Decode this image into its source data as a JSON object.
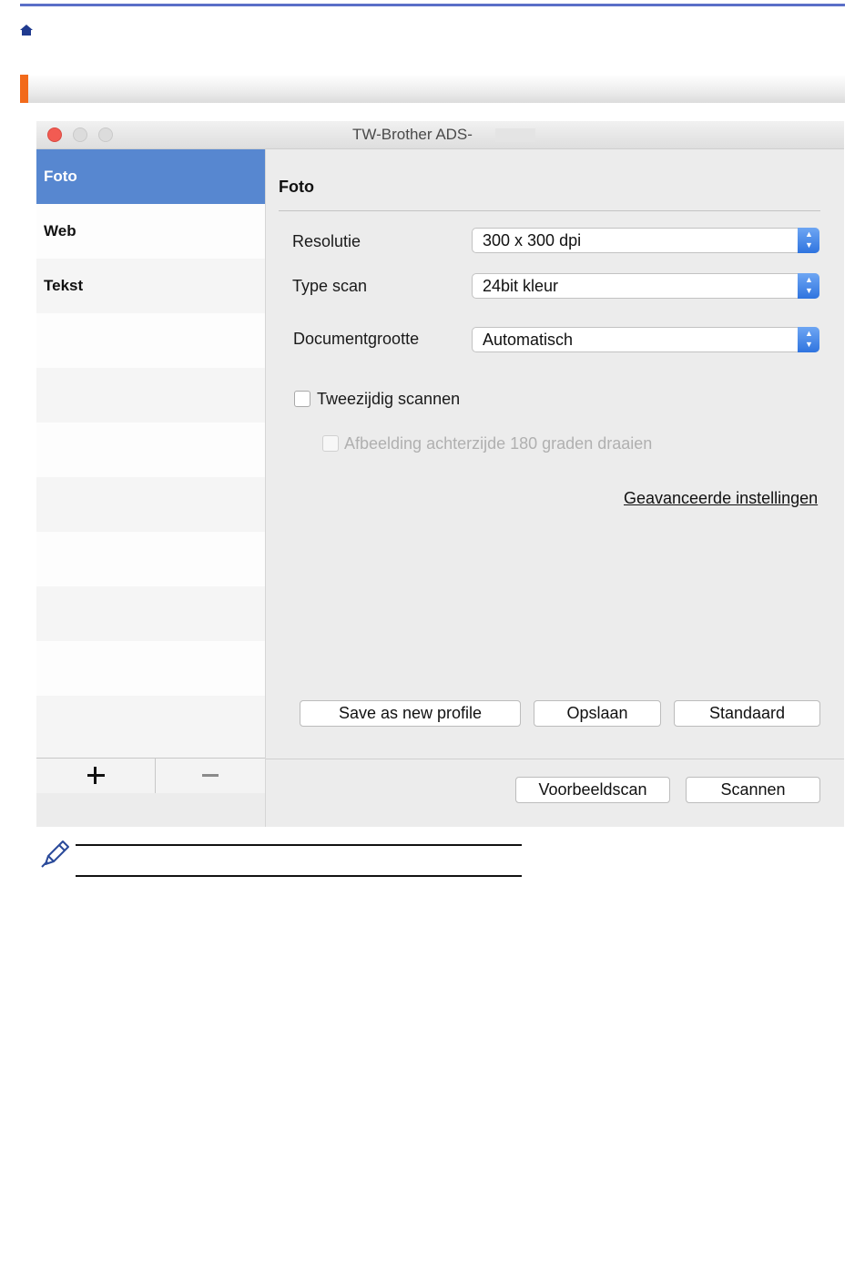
{
  "icons": {
    "home": "home-icon",
    "note": "pencil-note-icon"
  },
  "colors": {
    "accent_rule": "#5a6fc8",
    "section_accent": "#f26a1b",
    "selected": "#5787d0",
    "stepper": "#2f74df",
    "close": "#f25b52"
  },
  "window": {
    "title": "TW-Brother ADS-"
  },
  "sidebar": {
    "items": [
      {
        "label": "Foto",
        "selected": true
      },
      {
        "label": "Web",
        "selected": false
      },
      {
        "label": "Tekst",
        "selected": false
      }
    ],
    "add_icon": "plus-icon",
    "remove_icon": "minus-icon"
  },
  "panel": {
    "heading": "Foto",
    "resolution": {
      "label": "Resolutie",
      "value": "300 x 300 dpi"
    },
    "scan_type": {
      "label": "Type scan",
      "value": "24bit kleur"
    },
    "document_size": {
      "label": "Documentgrootte",
      "value": "Automatisch"
    },
    "duplex": {
      "label": "Tweezijdig scannen",
      "checked": false
    },
    "rotate_back": {
      "label": "Afbeelding achterzijde 180 graden draaien",
      "checked": false,
      "disabled": true
    },
    "advanced_link": "Geavanceerde instellingen",
    "buttons": {
      "save_new": "Save as new profile",
      "save": "Opslaan",
      "default": "Standaard"
    },
    "footer": {
      "preview": "Voorbeeldscan",
      "scan": "Scannen"
    }
  }
}
